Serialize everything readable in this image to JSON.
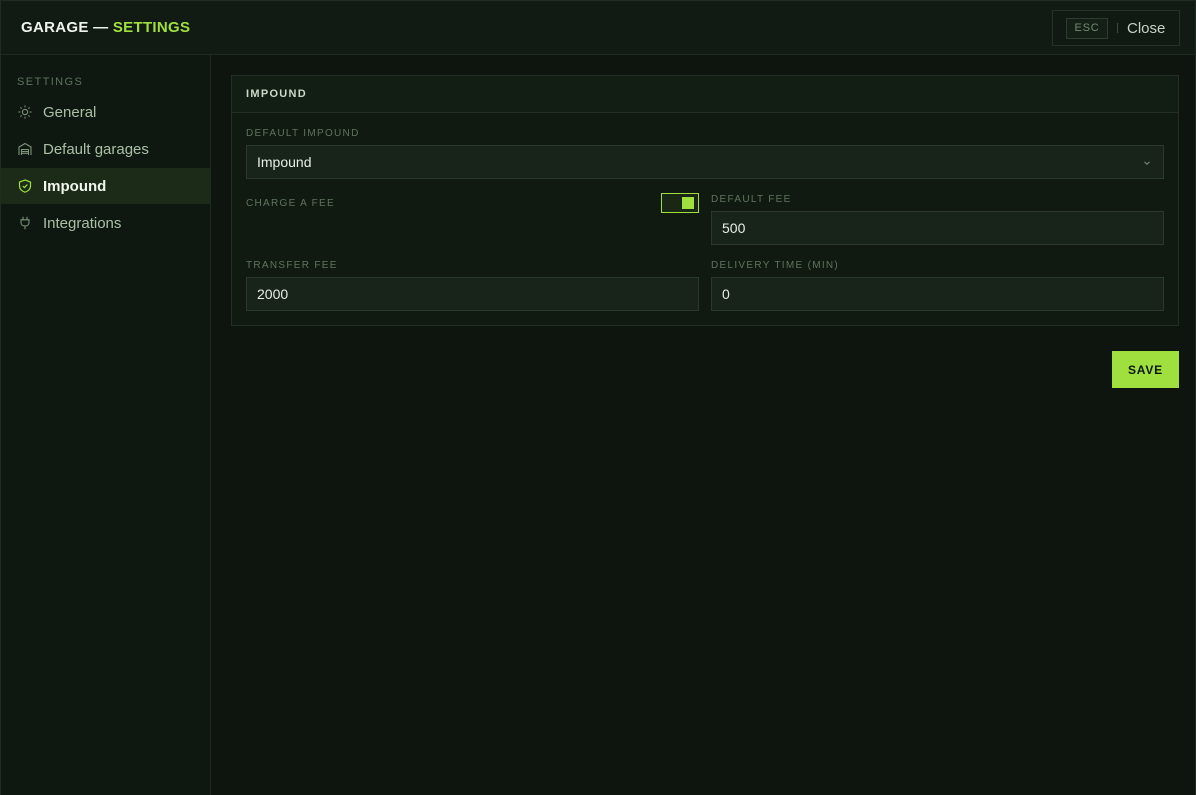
{
  "header": {
    "title_prefix": "GARAGE —",
    "title_accent": "SETTINGS",
    "esc_key": "ESC",
    "close_label": "Close"
  },
  "sidebar": {
    "section_label": "SETTINGS",
    "items": [
      {
        "label": "General",
        "icon": "sun-icon",
        "active": false
      },
      {
        "label": "Default garages",
        "icon": "garage-icon",
        "active": false
      },
      {
        "label": "Impound",
        "icon": "shield-icon",
        "active": true
      },
      {
        "label": "Integrations",
        "icon": "plug-icon",
        "active": false
      }
    ]
  },
  "panel": {
    "title": "IMPOUND",
    "default_impound": {
      "label": "DEFAULT IMPOUND",
      "value": "Impound"
    },
    "charge_fee": {
      "label": "CHARGE A FEE",
      "enabled": true
    },
    "default_fee": {
      "label": "DEFAULT FEE",
      "value": "500"
    },
    "transfer_fee": {
      "label": "TRANSFER FEE",
      "value": "2000"
    },
    "delivery_time": {
      "label": "DELIVERY TIME (MIN)",
      "value": "0"
    }
  },
  "actions": {
    "save_label": "SAVE"
  },
  "colors": {
    "accent": "#9fe03e",
    "background": "#0d150e"
  }
}
